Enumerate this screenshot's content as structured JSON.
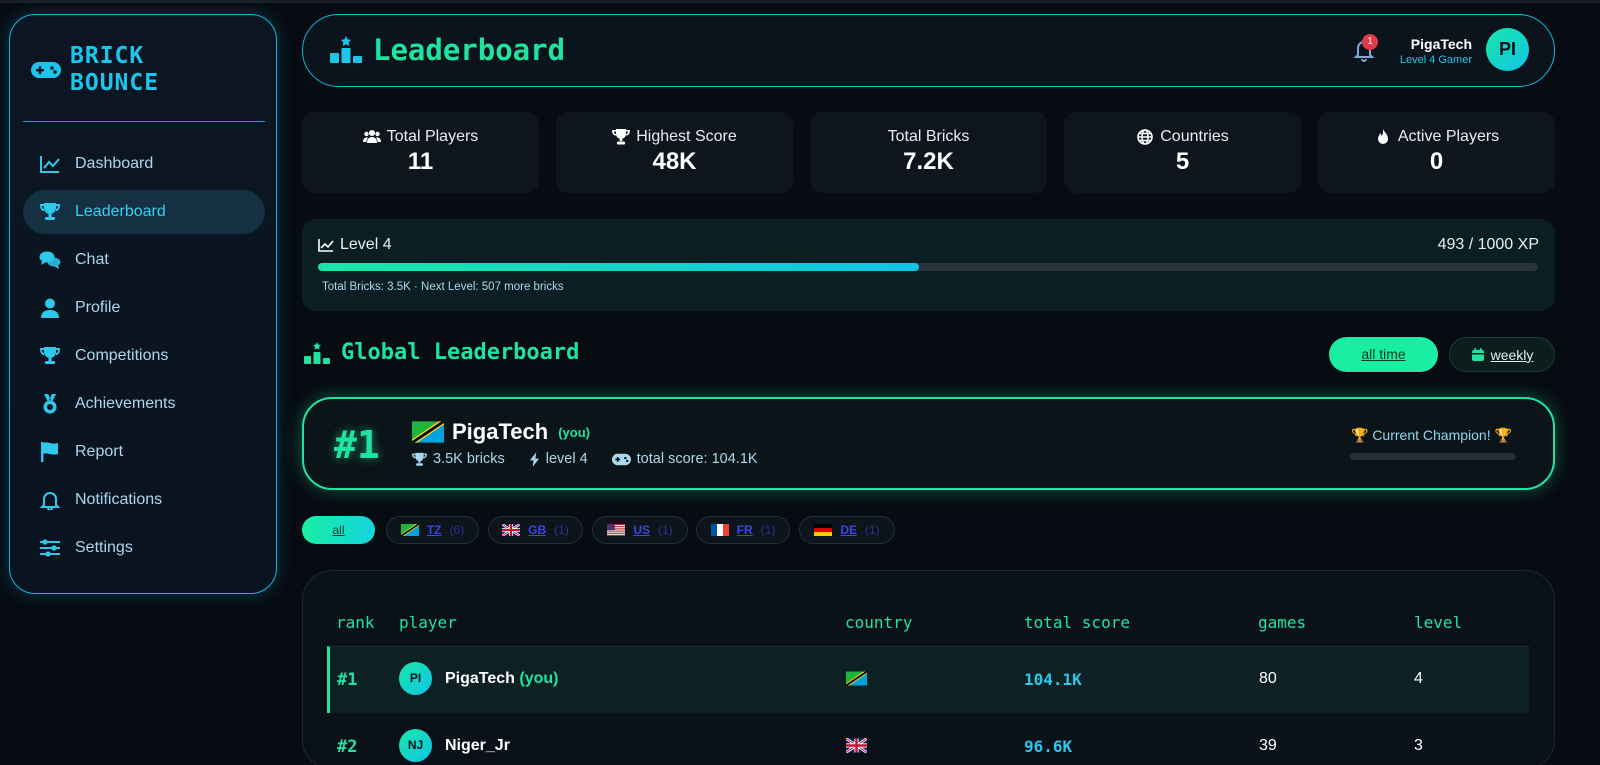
{
  "sidebar": {
    "brand_line1": "BRICK",
    "brand_line2": "BOUNCE",
    "items": [
      {
        "label": "Dashboard",
        "icon": "chart-line-icon"
      },
      {
        "label": "Leaderboard",
        "icon": "trophy-icon",
        "active": true
      },
      {
        "label": "Chat",
        "icon": "chat-icon"
      },
      {
        "label": "Profile",
        "icon": "user-icon"
      },
      {
        "label": "Competitions",
        "icon": "trophy-icon"
      },
      {
        "label": "Achievements",
        "icon": "medal-icon"
      },
      {
        "label": "Report",
        "icon": "flag-icon"
      },
      {
        "label": "Notifications",
        "icon": "bell-icon"
      },
      {
        "label": "Settings",
        "icon": "sliders-icon"
      }
    ]
  },
  "header": {
    "title": "Leaderboard",
    "notification_count": "1",
    "user_name": "PigaTech",
    "user_level": "Level 4 Gamer",
    "avatar_initials": "PI"
  },
  "stats": [
    {
      "label": "Total Players",
      "value": "11",
      "icon": "users-icon"
    },
    {
      "label": "Highest Score",
      "value": "48K",
      "icon": "trophy-icon"
    },
    {
      "label": "Total Bricks",
      "value": "7.2K",
      "icon": ""
    },
    {
      "label": "Countries",
      "value": "5",
      "icon": "globe-icon"
    },
    {
      "label": "Active Players",
      "value": "0",
      "icon": "fire-icon"
    }
  ],
  "level": {
    "title": "Level 4",
    "xp": "493 / 1000 XP",
    "progress_fraction": 0.493,
    "subtitle": "Total Bricks: 3.5K · Next Level: 507 more bricks"
  },
  "global": {
    "title": "Global Leaderboard",
    "all_time_label": "all time",
    "weekly_label": "weekly"
  },
  "champion": {
    "rank": "#1",
    "name": "PigaTech",
    "you": "(you)",
    "bricks": "3.5K bricks",
    "level": "level 4",
    "total_score": "total score: 104.1K",
    "badge": "🏆 Current Champion! 🏆"
  },
  "filters": [
    {
      "code": "all",
      "count": ""
    },
    {
      "code": "TZ",
      "count": "(6)"
    },
    {
      "code": "GB",
      "count": "(1)"
    },
    {
      "code": "US",
      "count": "(1)"
    },
    {
      "code": "FR",
      "count": "(1)"
    },
    {
      "code": "DE",
      "count": "(1)"
    }
  ],
  "table": {
    "headers": [
      "rank",
      "player",
      "country",
      "total score",
      "games",
      "level"
    ],
    "rows": [
      {
        "rank": "#1",
        "initials": "PI",
        "player": "PigaTech",
        "you": "(you)",
        "country": "TZ",
        "score": "104.1K",
        "games": "80",
        "level": "4"
      },
      {
        "rank": "#2",
        "initials": "NJ",
        "player": "Niger_Jr",
        "you": "",
        "country": "GB",
        "score": "96.6K",
        "games": "39",
        "level": "3"
      }
    ]
  },
  "colors": {
    "accent_green": "#1ee4a0",
    "accent_cyan": "#11b8e0",
    "background": "#070b12"
  }
}
